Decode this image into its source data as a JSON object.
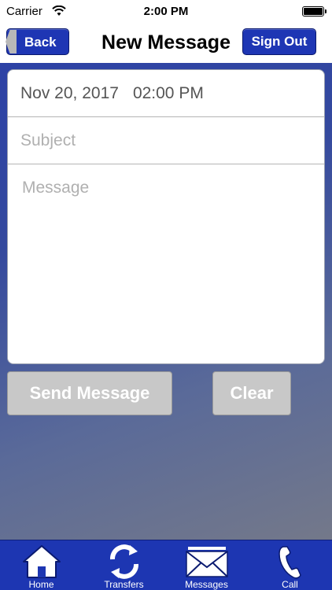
{
  "status_bar": {
    "carrier": "Carrier",
    "time": "2:00 PM"
  },
  "nav": {
    "back_label": "Back",
    "title": "New Message",
    "sign_out_label": "Sign Out"
  },
  "form": {
    "date": "Nov 20, 2017",
    "time": "02:00 PM",
    "subject_placeholder": "Subject",
    "message_placeholder": "Message"
  },
  "actions": {
    "send_label": "Send Message",
    "clear_label": "Clear"
  },
  "tabs": [
    {
      "label": "Home",
      "icon": "home-icon"
    },
    {
      "label": "Transfers",
      "icon": "transfers-icon"
    },
    {
      "label": "Messages",
      "icon": "messages-icon"
    },
    {
      "label": "Call",
      "icon": "phone-icon"
    }
  ],
  "colors": {
    "nav_button": "#1e36b4",
    "tab_bar": "#1d36b2",
    "disabled_button": "#c8c8c8"
  }
}
